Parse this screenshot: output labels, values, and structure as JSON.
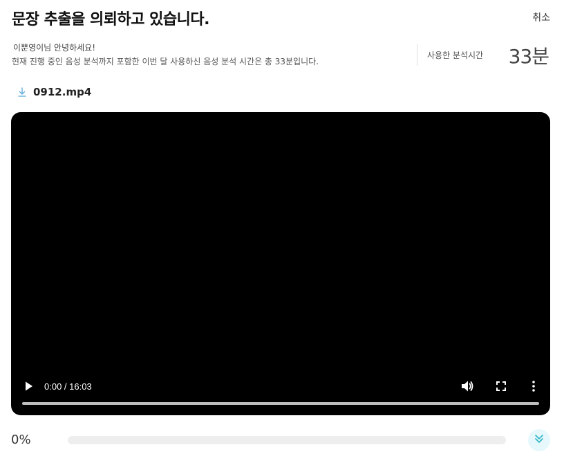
{
  "header": {
    "title": "문장 추출을 의뢰하고 있습니다.",
    "cancel_label": "취소"
  },
  "info": {
    "greeting": "이뿐영이님 안녕하세요!",
    "usage_description": "현재 진행 중인 음성 분석까지 포함한 이번 달 사용하신 음성 분석 시간은 총 33분입니다.",
    "usage_label": "사용한 분석시간",
    "usage_value": "33분"
  },
  "file": {
    "name": "0912.mp4",
    "icon": "download-icon"
  },
  "player": {
    "time_display": "0:00 / 16:03",
    "current_time": "0:00",
    "duration": "16:03",
    "icons": [
      "play-icon",
      "volume-icon",
      "fullscreen-icon",
      "more-vertical-icon"
    ]
  },
  "progress": {
    "percent_label": "0%",
    "value": 0,
    "expand_icon": "double-chevron-down-icon"
  },
  "colors": {
    "accent": "#3bbfd0",
    "player_bg": "#000000",
    "track": "#eeeeee"
  }
}
